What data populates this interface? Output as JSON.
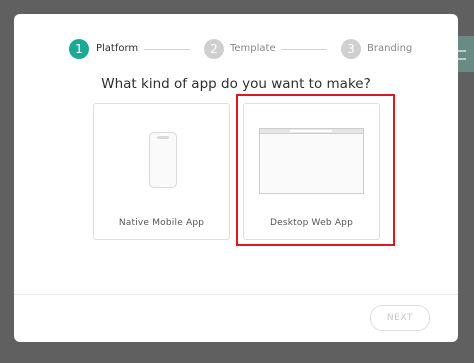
{
  "stepper": {
    "steps": [
      {
        "number": "1",
        "label": "Platform",
        "active": true
      },
      {
        "number": "2",
        "label": "Template",
        "active": false
      },
      {
        "number": "3",
        "label": "Branding",
        "active": false
      }
    ],
    "active_color": "#1aa897",
    "inactive_color": "#cfcfcf"
  },
  "title": "What kind of app do you want to make?",
  "options": [
    {
      "label": "Native Mobile App",
      "icon": "phone-icon"
    },
    {
      "label": "Desktop Web App",
      "icon": "browser-window-icon"
    }
  ],
  "highlight_color": "#d81b21",
  "footer": {
    "next_label": "NEXT"
  }
}
